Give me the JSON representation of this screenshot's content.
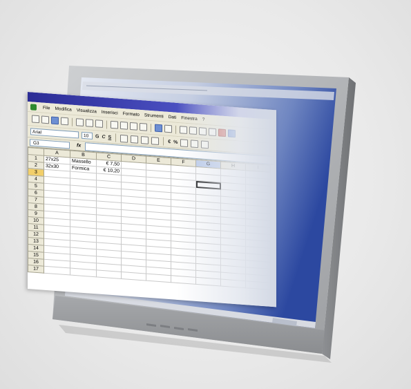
{
  "menu": {
    "items": [
      "File",
      "Modifica",
      "Visualizza",
      "Inserisci",
      "Formato",
      "Strumenti",
      "Dati",
      "Finestra",
      "?"
    ]
  },
  "format_bar": {
    "font_name": "Arial",
    "font_size": "10",
    "bold": "G",
    "italic": "C",
    "underline": "S",
    "currency": "€",
    "percent": "%"
  },
  "formula_bar": {
    "name_box": "G3",
    "fx_label": "fx"
  },
  "grid": {
    "columns": [
      "A",
      "B",
      "C",
      "D",
      "E",
      "F",
      "G",
      "H",
      "I"
    ],
    "rows": [
      "1",
      "2",
      "3",
      "4",
      "5",
      "6",
      "7",
      "8",
      "9",
      "10",
      "11",
      "12",
      "13",
      "14",
      "15",
      "16",
      "17"
    ],
    "selected_cell": "G3",
    "cells": [
      [
        "27x25",
        "Massello",
        "€ 7,50"
      ],
      [
        "32x30",
        "Formica",
        "€ 10,20"
      ]
    ]
  },
  "colors": {
    "title_bar": "#2b2c95",
    "toolbar": "#ece9d8",
    "monitor_bezel": "#b9bbbd",
    "desktop": "#2c48a0"
  },
  "icons": [
    "app-icon",
    "new-icon",
    "open-icon",
    "save-icon",
    "print-icon",
    "preview-icon",
    "spell-icon",
    "cut-icon",
    "copy-icon",
    "paste-icon",
    "undo-icon",
    "redo-icon",
    "sum-icon",
    "sort-asc-icon",
    "sort-desc-icon",
    "chart-icon"
  ]
}
